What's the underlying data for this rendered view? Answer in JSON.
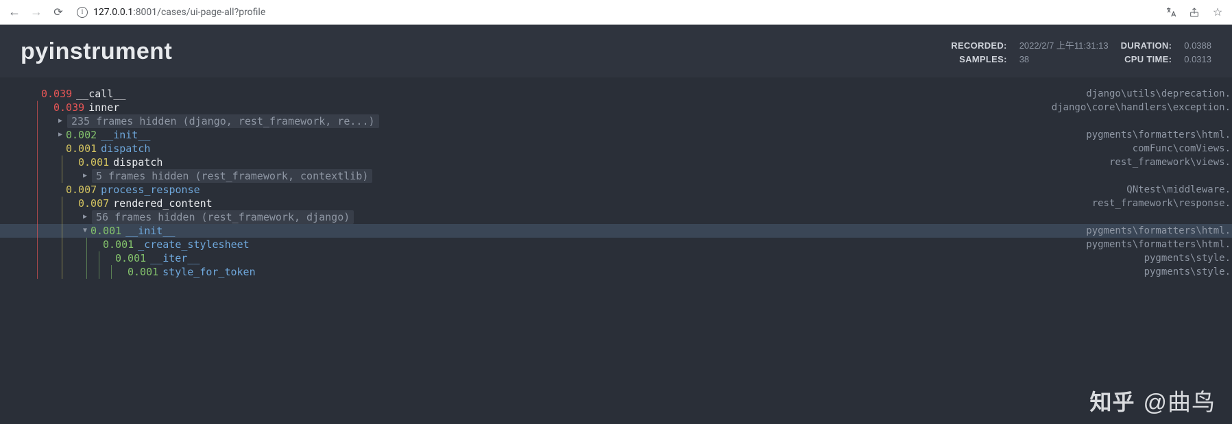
{
  "browser": {
    "url_host": "127.0.0.1",
    "url_port": ":8001",
    "url_path": "/cases/ui-page-all?profile"
  },
  "header": {
    "brand": "pyinstrument",
    "recorded_label": "RECORDED:",
    "recorded_value": "2022/2/7 上午11:31:13",
    "samples_label": "SAMPLES:",
    "samples_value": "38",
    "duration_label": "DURATION:",
    "duration_value": "0.0388",
    "cputime_label": "CPU TIME:",
    "cputime_value": "0.0313"
  },
  "rows": [
    {
      "depth": 0,
      "bars": [],
      "caret": "",
      "time": "0.039",
      "tclass": "t-red",
      "name": "__call__",
      "nclass": "f-white",
      "loc": "django\\utils\\deprecation."
    },
    {
      "depth": 1,
      "bars": [
        "bar-red"
      ],
      "caret": "",
      "time": "0.039",
      "tclass": "t-red",
      "name": "inner",
      "nclass": "f-white",
      "loc": "django\\core\\handlers\\exception."
    },
    {
      "depth": 2,
      "bars": [
        "bar-red",
        ""
      ],
      "caret": "▶",
      "hidden": "235 frames hidden (django, rest_framework, re...)",
      "loc": ""
    },
    {
      "depth": 2,
      "bars": [
        "bar-red",
        ""
      ],
      "caret": "▶",
      "time": "0.002",
      "tclass": "t-green",
      "name": "__init__",
      "nclass": "f-link",
      "loc": "pygments\\formatters\\html."
    },
    {
      "depth": 2,
      "bars": [
        "bar-red",
        ""
      ],
      "caret": "",
      "time": "0.001",
      "tclass": "t-yellow",
      "name": "dispatch",
      "nclass": "f-link",
      "loc": "comFunc\\comViews."
    },
    {
      "depth": 3,
      "bars": [
        "bar-red",
        "",
        "bar-yellow"
      ],
      "caret": "",
      "time": "0.001",
      "tclass": "t-yellow",
      "name": "dispatch",
      "nclass": "f-white",
      "loc": "rest_framework\\views."
    },
    {
      "depth": 4,
      "bars": [
        "bar-red",
        "",
        "bar-yellow",
        ""
      ],
      "caret": "▶",
      "hidden": "5 frames hidden (rest_framework, contextlib)",
      "loc": ""
    },
    {
      "depth": 2,
      "bars": [
        "bar-red",
        ""
      ],
      "caret": "",
      "time": "0.007",
      "tclass": "t-yellow",
      "name": "process_response",
      "nclass": "f-link",
      "loc": "QNtest\\middleware."
    },
    {
      "depth": 3,
      "bars": [
        "bar-red",
        "",
        "bar-yellow"
      ],
      "caret": "",
      "time": "0.007",
      "tclass": "t-yellow",
      "name": "rendered_content",
      "nclass": "f-white",
      "loc": "rest_framework\\response."
    },
    {
      "depth": 4,
      "bars": [
        "bar-red",
        "",
        "bar-yellow",
        ""
      ],
      "caret": "▶",
      "hidden": "56 frames hidden (rest_framework, django)",
      "loc": ""
    },
    {
      "depth": 4,
      "bars": [
        "bar-red",
        "",
        "bar-yellow",
        ""
      ],
      "caret": "▼",
      "time": "0.001",
      "tclass": "t-green",
      "name": "__init__",
      "nclass": "f-link",
      "loc": "pygments\\formatters\\html.",
      "highlight": true
    },
    {
      "depth": 5,
      "bars": [
        "bar-red",
        "",
        "bar-yellow",
        "",
        "bar-green"
      ],
      "caret": "",
      "time": "0.001",
      "tclass": "t-green",
      "name": "_create_stylesheet",
      "nclass": "f-link",
      "loc": "pygments\\formatters\\html."
    },
    {
      "depth": 6,
      "bars": [
        "bar-red",
        "",
        "bar-yellow",
        "",
        "bar-green",
        "bar-green"
      ],
      "caret": "",
      "time": "0.001",
      "tclass": "t-green",
      "name": "__iter__",
      "nclass": "f-link",
      "loc": "pygments\\style."
    },
    {
      "depth": 7,
      "bars": [
        "bar-red",
        "",
        "bar-yellow",
        "",
        "bar-green",
        "bar-green",
        "bar-green"
      ],
      "caret": "",
      "time": "0.001",
      "tclass": "t-green",
      "name": "style_for_token",
      "nclass": "f-link",
      "loc": "pygments\\style."
    }
  ],
  "watermark": {
    "logo": "知乎",
    "text": "@曲鸟"
  }
}
